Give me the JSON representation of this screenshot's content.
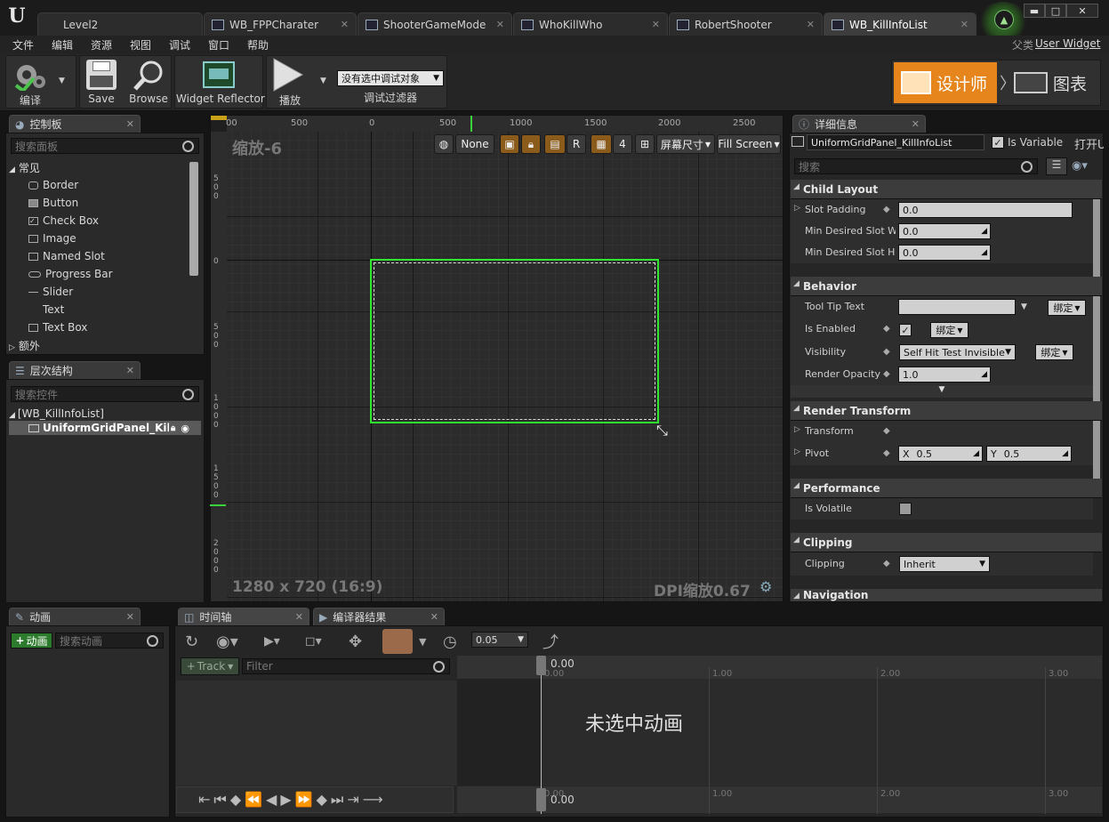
{
  "tabs": [
    {
      "label": "Level2"
    },
    {
      "label": "WB_FPPCharater"
    },
    {
      "label": "ShooterGameMode"
    },
    {
      "label": "WhoKillWho"
    },
    {
      "label": "RobertShooter"
    },
    {
      "label": "WB_KillInfoList"
    }
  ],
  "window_controls": {
    "minimize": "▬",
    "maximize": "□",
    "close": "✕"
  },
  "parent_class": {
    "label": "父类",
    "value": "User Widget"
  },
  "menu": [
    "文件",
    "编辑",
    "资源",
    "视图",
    "调试",
    "窗口",
    "帮助"
  ],
  "toolbar": {
    "compile": "编译",
    "save": "Save",
    "browse": "Browse",
    "reflector": "Widget Reflector",
    "play": "播放",
    "debug_select": "没有选中调试对象",
    "debug_filter": "调试过滤器",
    "designer": "设计师",
    "graph": "图表"
  },
  "palette": {
    "tab": "控制板",
    "search_placeholder": "搜索面板",
    "category_common": "常见",
    "items": [
      "Border",
      "Button",
      "Check Box",
      "Image",
      "Named Slot",
      "Progress Bar",
      "Slider",
      "Text",
      "Text Box"
    ],
    "category_extra": "额外"
  },
  "hierarchy": {
    "tab": "层次结构",
    "search_placeholder": "搜索控件",
    "root": "[WB_KillInfoList]",
    "child": "UniformGridPanel_KillInf"
  },
  "canvas": {
    "zoom": "缩放-6",
    "resolution": "1280 x 720 (16:9)",
    "dpi": "DPI缩放0.67",
    "ruler_top": [
      "00",
      "500",
      "0",
      "500",
      "1000",
      "1500",
      "2000",
      "2500"
    ],
    "ruler_left": [
      "5\n0\n0",
      "0",
      "5\n0\n0",
      "1\n0\n0\n0",
      "1\n5\n0\n0",
      "2\n0\n0\n0"
    ],
    "toolbar": {
      "none": "None",
      "r": "R",
      "grid_num": "4",
      "screen_size": "屏幕尺寸",
      "fill": "Fill Screen"
    }
  },
  "details": {
    "tab": "详细信息",
    "name": "UniformGridPanel_KillInfoList",
    "is_variable": "Is Variable",
    "open": "打开U",
    "search_placeholder": "搜索",
    "bind": "绑定",
    "sections": {
      "child_layout": "Child Layout",
      "behavior": "Behavior",
      "render_transform": "Render Transform",
      "performance": "Performance",
      "clipping": "Clipping",
      "navigation": "Navigation"
    },
    "props": {
      "slot_padding": {
        "label": "Slot Padding",
        "value": "0.0"
      },
      "min_slot_width": {
        "label": "Min Desired Slot Wid",
        "value": "0.0"
      },
      "min_slot_height": {
        "label": "Min Desired Slot Hei",
        "value": "0.0"
      },
      "tooltip": {
        "label": "Tool Tip Text",
        "value": ""
      },
      "is_enabled": {
        "label": "Is Enabled"
      },
      "visibility": {
        "label": "Visibility",
        "value": "Self Hit Test Invisible"
      },
      "render_opacity": {
        "label": "Render Opacity",
        "value": "1.0"
      },
      "transform": {
        "label": "Transform"
      },
      "pivot": {
        "label": "Pivot",
        "x_label": "X",
        "x": "0.5",
        "y_label": "Y",
        "y": "0.5"
      },
      "is_volatile": {
        "label": "Is Volatile"
      },
      "clipping": {
        "label": "Clipping",
        "value": "Inherit"
      }
    }
  },
  "animation": {
    "tab": "动画",
    "add": "动画",
    "search_placeholder": "搜索动画"
  },
  "timeline": {
    "tab": "时间轴",
    "compiler_tab": "编译器结果",
    "snap": "0.05",
    "track": "Track",
    "filter_placeholder": "Filter",
    "time_top": "0.00",
    "time_bottom": "0.00",
    "ticks": [
      "0.00",
      "1.00",
      "2.00",
      "3.00"
    ],
    "no_anim": "未选中动画"
  }
}
